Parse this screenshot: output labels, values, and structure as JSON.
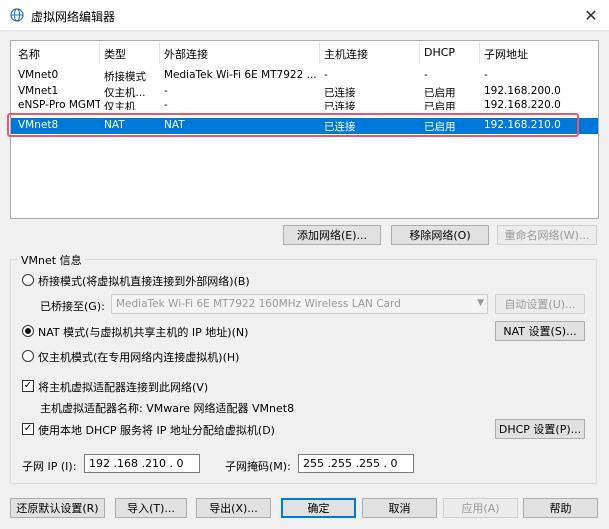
{
  "window": {
    "title": "虚拟网络编辑器",
    "close_glyph": "✕"
  },
  "list": {
    "headers": [
      "名称",
      "类型",
      "外部连接",
      "主机连接",
      "DHCP",
      "子网地址"
    ],
    "rows": [
      [
        "VMnet0",
        "桥接模式",
        "MediaTek Wi-Fi 6E MT7922 ...",
        "-",
        "-",
        "-"
      ],
      [
        "VMnet1",
        "仅主机...",
        "-",
        "已连接",
        "已启用",
        "192.168.200.0"
      ],
      [
        "eNSP-Pro MGMT",
        "仅主机",
        "-",
        "已连接",
        "已启用",
        "192.168.220.0"
      ],
      [
        "VMnet8",
        "NAT",
        "NAT",
        "已连接",
        "已启用",
        "192.168.210.0"
      ]
    ],
    "selected_index": 3
  },
  "list_buttons": {
    "add": "添加网络(E)...",
    "remove": "移除网络(O)",
    "rename": "重命名网络(W)..."
  },
  "vmnet_info": {
    "legend": "VMnet 信息",
    "bridged_label": "桥接模式(将虚拟机直接连接到外部网络)(B)",
    "bridged_to_label": "已桥接至(G):",
    "bridged_to_value": "MediaTek Wi-Fi 6E MT7922 160MHz Wireless LAN Card",
    "auto_settings": "自动设置(U)...",
    "nat_label": "NAT 模式(与虚拟机共享主机的 IP 地址)(N)",
    "nat_settings": "NAT 设置(S)...",
    "hostonly_label": "仅主机模式(在专用网络内连接虚拟机)(H)",
    "selected_mode": "nat",
    "connect_adapter_label": "将主机虚拟适配器连接到此网络(V)",
    "adapter_name_label": "主机虚拟适配器名称: VMware 网络适配器 VMnet8",
    "dhcp_label": "使用本地 DHCP 服务将 IP 地址分配给虚拟机(D)",
    "dhcp_settings": "DHCP 设置(P)...",
    "subnet_ip_label": "子网 IP (I):",
    "subnet_ip_value": "192 .168 .210 . 0",
    "subnet_mask_label": "子网掩码(M):",
    "subnet_mask_value": "255 .255 .255 . 0",
    "connect_adapter_checked": true,
    "dhcp_checked": true
  },
  "footer": {
    "restore": "还原默认设置(R)",
    "import": "导入(T)...",
    "export": "导出(X)...",
    "ok": "确定",
    "cancel": "取消",
    "apply": "应用(A)",
    "help": "帮助"
  },
  "colors": {
    "selection": "#0078d7",
    "highlight_outline": "#e05a72"
  }
}
